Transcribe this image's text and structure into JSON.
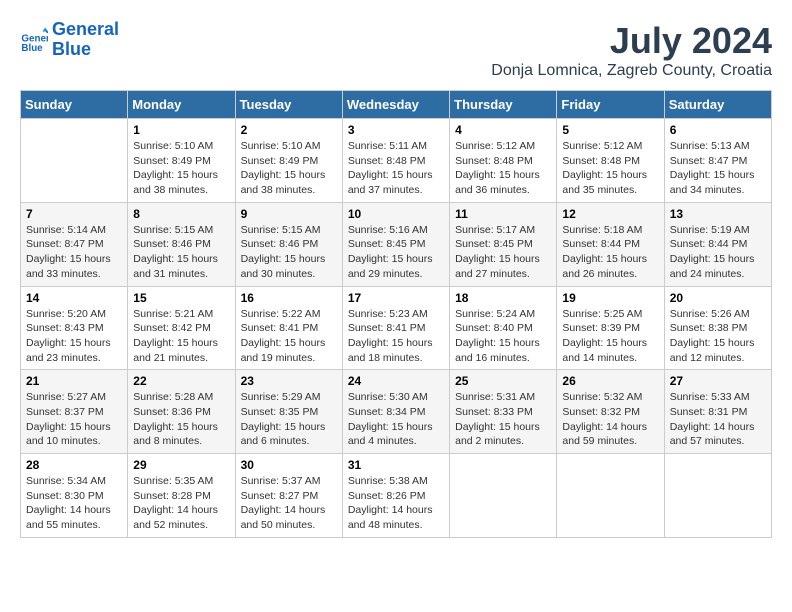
{
  "header": {
    "title": "July 2024",
    "subtitle": "Donja Lomnica, Zagreb County, Croatia",
    "logo_line1": "General",
    "logo_line2": "Blue"
  },
  "days_of_week": [
    "Sunday",
    "Monday",
    "Tuesday",
    "Wednesday",
    "Thursday",
    "Friday",
    "Saturday"
  ],
  "weeks": [
    [
      {
        "day": "",
        "sunrise": "",
        "sunset": "",
        "daylight": ""
      },
      {
        "day": "1",
        "sunrise": "Sunrise: 5:10 AM",
        "sunset": "Sunset: 8:49 PM",
        "daylight": "Daylight: 15 hours and 38 minutes."
      },
      {
        "day": "2",
        "sunrise": "Sunrise: 5:10 AM",
        "sunset": "Sunset: 8:49 PM",
        "daylight": "Daylight: 15 hours and 38 minutes."
      },
      {
        "day": "3",
        "sunrise": "Sunrise: 5:11 AM",
        "sunset": "Sunset: 8:48 PM",
        "daylight": "Daylight: 15 hours and 37 minutes."
      },
      {
        "day": "4",
        "sunrise": "Sunrise: 5:12 AM",
        "sunset": "Sunset: 8:48 PM",
        "daylight": "Daylight: 15 hours and 36 minutes."
      },
      {
        "day": "5",
        "sunrise": "Sunrise: 5:12 AM",
        "sunset": "Sunset: 8:48 PM",
        "daylight": "Daylight: 15 hours and 35 minutes."
      },
      {
        "day": "6",
        "sunrise": "Sunrise: 5:13 AM",
        "sunset": "Sunset: 8:47 PM",
        "daylight": "Daylight: 15 hours and 34 minutes."
      }
    ],
    [
      {
        "day": "7",
        "sunrise": "Sunrise: 5:14 AM",
        "sunset": "Sunset: 8:47 PM",
        "daylight": "Daylight: 15 hours and 33 minutes."
      },
      {
        "day": "8",
        "sunrise": "Sunrise: 5:15 AM",
        "sunset": "Sunset: 8:46 PM",
        "daylight": "Daylight: 15 hours and 31 minutes."
      },
      {
        "day": "9",
        "sunrise": "Sunrise: 5:15 AM",
        "sunset": "Sunset: 8:46 PM",
        "daylight": "Daylight: 15 hours and 30 minutes."
      },
      {
        "day": "10",
        "sunrise": "Sunrise: 5:16 AM",
        "sunset": "Sunset: 8:45 PM",
        "daylight": "Daylight: 15 hours and 29 minutes."
      },
      {
        "day": "11",
        "sunrise": "Sunrise: 5:17 AM",
        "sunset": "Sunset: 8:45 PM",
        "daylight": "Daylight: 15 hours and 27 minutes."
      },
      {
        "day": "12",
        "sunrise": "Sunrise: 5:18 AM",
        "sunset": "Sunset: 8:44 PM",
        "daylight": "Daylight: 15 hours and 26 minutes."
      },
      {
        "day": "13",
        "sunrise": "Sunrise: 5:19 AM",
        "sunset": "Sunset: 8:44 PM",
        "daylight": "Daylight: 15 hours and 24 minutes."
      }
    ],
    [
      {
        "day": "14",
        "sunrise": "Sunrise: 5:20 AM",
        "sunset": "Sunset: 8:43 PM",
        "daylight": "Daylight: 15 hours and 23 minutes."
      },
      {
        "day": "15",
        "sunrise": "Sunrise: 5:21 AM",
        "sunset": "Sunset: 8:42 PM",
        "daylight": "Daylight: 15 hours and 21 minutes."
      },
      {
        "day": "16",
        "sunrise": "Sunrise: 5:22 AM",
        "sunset": "Sunset: 8:41 PM",
        "daylight": "Daylight: 15 hours and 19 minutes."
      },
      {
        "day": "17",
        "sunrise": "Sunrise: 5:23 AM",
        "sunset": "Sunset: 8:41 PM",
        "daylight": "Daylight: 15 hours and 18 minutes."
      },
      {
        "day": "18",
        "sunrise": "Sunrise: 5:24 AM",
        "sunset": "Sunset: 8:40 PM",
        "daylight": "Daylight: 15 hours and 16 minutes."
      },
      {
        "day": "19",
        "sunrise": "Sunrise: 5:25 AM",
        "sunset": "Sunset: 8:39 PM",
        "daylight": "Daylight: 15 hours and 14 minutes."
      },
      {
        "day": "20",
        "sunrise": "Sunrise: 5:26 AM",
        "sunset": "Sunset: 8:38 PM",
        "daylight": "Daylight: 15 hours and 12 minutes."
      }
    ],
    [
      {
        "day": "21",
        "sunrise": "Sunrise: 5:27 AM",
        "sunset": "Sunset: 8:37 PM",
        "daylight": "Daylight: 15 hours and 10 minutes."
      },
      {
        "day": "22",
        "sunrise": "Sunrise: 5:28 AM",
        "sunset": "Sunset: 8:36 PM",
        "daylight": "Daylight: 15 hours and 8 minutes."
      },
      {
        "day": "23",
        "sunrise": "Sunrise: 5:29 AM",
        "sunset": "Sunset: 8:35 PM",
        "daylight": "Daylight: 15 hours and 6 minutes."
      },
      {
        "day": "24",
        "sunrise": "Sunrise: 5:30 AM",
        "sunset": "Sunset: 8:34 PM",
        "daylight": "Daylight: 15 hours and 4 minutes."
      },
      {
        "day": "25",
        "sunrise": "Sunrise: 5:31 AM",
        "sunset": "Sunset: 8:33 PM",
        "daylight": "Daylight: 15 hours and 2 minutes."
      },
      {
        "day": "26",
        "sunrise": "Sunrise: 5:32 AM",
        "sunset": "Sunset: 8:32 PM",
        "daylight": "Daylight: 14 hours and 59 minutes."
      },
      {
        "day": "27",
        "sunrise": "Sunrise: 5:33 AM",
        "sunset": "Sunset: 8:31 PM",
        "daylight": "Daylight: 14 hours and 57 minutes."
      }
    ],
    [
      {
        "day": "28",
        "sunrise": "Sunrise: 5:34 AM",
        "sunset": "Sunset: 8:30 PM",
        "daylight": "Daylight: 14 hours and 55 minutes."
      },
      {
        "day": "29",
        "sunrise": "Sunrise: 5:35 AM",
        "sunset": "Sunset: 8:28 PM",
        "daylight": "Daylight: 14 hours and 52 minutes."
      },
      {
        "day": "30",
        "sunrise": "Sunrise: 5:37 AM",
        "sunset": "Sunset: 8:27 PM",
        "daylight": "Daylight: 14 hours and 50 minutes."
      },
      {
        "day": "31",
        "sunrise": "Sunrise: 5:38 AM",
        "sunset": "Sunset: 8:26 PM",
        "daylight": "Daylight: 14 hours and 48 minutes."
      },
      {
        "day": "",
        "sunrise": "",
        "sunset": "",
        "daylight": ""
      },
      {
        "day": "",
        "sunrise": "",
        "sunset": "",
        "daylight": ""
      },
      {
        "day": "",
        "sunrise": "",
        "sunset": "",
        "daylight": ""
      }
    ]
  ]
}
